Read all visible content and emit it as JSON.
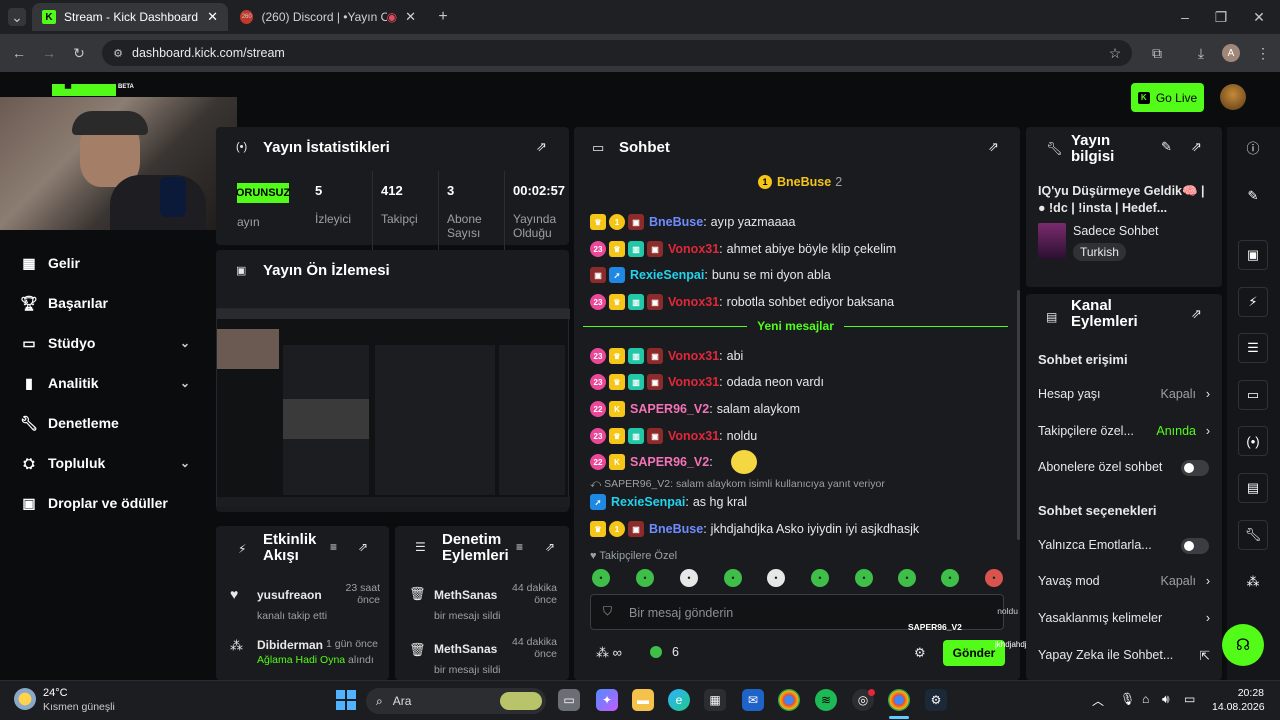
{
  "browser": {
    "tabs": [
      {
        "title": "Stream - Kick Dashboard"
      },
      {
        "title": "(260) Discord | •Yayın O"
      }
    ],
    "url": "dashboard.kick.com/stream",
    "profile_initial": "A"
  },
  "header": {
    "logo_badge": "BETA",
    "go_live": "Go Live"
  },
  "nav": {
    "items": [
      {
        "label": "Gelir",
        "icon": "dollar-icon"
      },
      {
        "label": "Başarılar",
        "icon": "trophy-icon"
      },
      {
        "label": "Stüdyo",
        "icon": "studio-icon"
      },
      {
        "label": "Analitik",
        "icon": "analytics-icon"
      },
      {
        "label": "Denetleme",
        "icon": "wrench-icon"
      },
      {
        "label": "Topluluk",
        "icon": "community-icon"
      },
      {
        "label": "Droplar ve ödüller",
        "icon": "gift-icon"
      }
    ]
  },
  "stats": {
    "title": "Yayın İstatistikleri",
    "status_badge": "ORUNSUZ",
    "status_label": "ayın",
    "items": [
      {
        "value": "5",
        "label": "İzleyici"
      },
      {
        "value": "412",
        "label": "Takipçi"
      },
      {
        "value": "3",
        "label": "Abone Sayısı"
      },
      {
        "value": "00:02:57",
        "label": "Yayında Olduğu"
      }
    ]
  },
  "preview": {
    "title": "Yayın Ön İzlemesi"
  },
  "activity": {
    "title": "Etkinlik Akışı",
    "items": [
      {
        "user": "yusufreaon",
        "time": "23 saat önce",
        "text": "kanalı takip etti"
      },
      {
        "user": "Dibiderman",
        "time": "1 gün önce",
        "text_highlight": "Ağlama Hadi Oyna",
        "text": " alındı"
      }
    ]
  },
  "moderation": {
    "title": "Denetim Eylemleri",
    "items": [
      {
        "user": "MethSanas",
        "time": "44 dakika önce",
        "text": "bir mesajı sildi"
      },
      {
        "user": "MethSanas",
        "time": "44 dakika önce",
        "text": "bir mesajı sildi"
      }
    ]
  },
  "chat": {
    "title": "Sohbet",
    "pinned_user": "BneBuse",
    "pinned_count": "2",
    "new_messages": "Yeni mesajlar",
    "messages": [
      {
        "user": "BneBuse",
        "color": "#6f8cff",
        "text": "ayıp yazmaaaa"
      },
      {
        "user": "Vonox31",
        "color": "#e0283a",
        "text": "ahmet abiye böyle klip çekelim"
      },
      {
        "user": "RexieSenpai",
        "color": "#22d3ee",
        "text": "bunu se mi dyon abla"
      },
      {
        "user": "Vonox31",
        "color": "#e0283a",
        "text": "robotla sohbet ediyor baksana"
      },
      {
        "user": "Vonox31",
        "color": "#e0283a",
        "text": "abi"
      },
      {
        "user": "Vonox31",
        "color": "#e0283a",
        "text": "odada neon vardı"
      },
      {
        "user": "SAPER96_V2",
        "color": "#f472b6",
        "text": "salam alaykom"
      },
      {
        "user": "Vonox31",
        "color": "#e0283a",
        "text": "noldu"
      },
      {
        "user": "SAPER96_V2",
        "color": "#f472b6",
        "text": ""
      },
      {
        "user": "RexieSenpai",
        "color": "#22d3ee",
        "text": "as hg kral"
      },
      {
        "user": "BneBuse",
        "color": "#6f8cff",
        "text": "jkhdjahdjka Asko iyiydin iyi asjkdhasjk"
      }
    ],
    "reply_note": "SAPER96_V2: salam alaykom isimli kullanıcıya yanıt veriyor",
    "followers_only": "Takipçilere Özel",
    "input_placeholder": "Bir mesaj gönderin",
    "points": "6",
    "send": "Gönder",
    "overlay_user": "SAPER96_V2",
    "overlay_text": "noldu",
    "overlay_text2": "jkhdjahdjka Asko iyiydin iyi asjkdhasjk"
  },
  "stream_info": {
    "title": "Yayın bilgisi",
    "stream_title": "IQ'yu Düşürmeye Geldik🧠 | ● !dc | !insta | Hedef...",
    "category": "Sadece Sohbet",
    "language": "Turkish"
  },
  "channel_actions": {
    "title": "Kanal Eylemleri",
    "chat_access": "Sohbet erişimi",
    "rows1": [
      {
        "label": "Hesap yaşı",
        "value": "Kapalı"
      },
      {
        "label": "Takipçilere özel...",
        "value": "Anında"
      },
      {
        "label": "Abonelere özel sohbet",
        "value": ""
      }
    ],
    "chat_options": "Sohbet seçenekleri",
    "rows2": [
      {
        "label": "Yalnızca Emotlarla...",
        "value": ""
      },
      {
        "label": "Yavaş mod",
        "value": "Kapalı"
      },
      {
        "label": "Yasaklanmış kelimeler",
        "value": ""
      },
      {
        "label": "Yapay Zeka ile Sohbet...",
        "value": ""
      }
    ]
  },
  "taskbar": {
    "weather_temp": "24°C",
    "weather_desc": "Kısmen güneşli",
    "search": "Ara",
    "time": "20:28",
    "date": "14.08.2026"
  },
  "colors": {
    "accent": "#53fc18",
    "panel": "#191b1f",
    "bg": "#0b0c0d"
  }
}
